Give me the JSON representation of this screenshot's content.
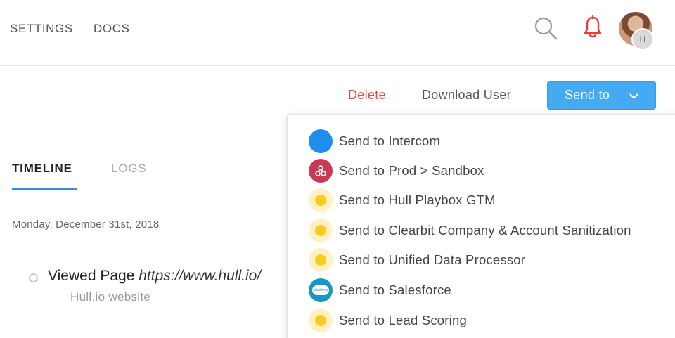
{
  "nav": {
    "settings_label": "SETTINGS",
    "docs_label": "DOCS",
    "search_icon": "search-icon",
    "bell_icon": "bell-icon",
    "avatar_badge": "H",
    "bell_color": "#ef3b3b"
  },
  "actions": {
    "delete_label": "Delete",
    "download_label": "Download User",
    "sendto_label": "Send to",
    "accent_color": "#45aaf2",
    "delete_color": "#e8473b"
  },
  "tabs": {
    "timeline_label": "TIMELINE",
    "logs_label": "LOGS"
  },
  "timeline": {
    "date": "Monday, December 31st, 2018",
    "event_title": "Viewed Page",
    "event_url": "https://www.hull.io/",
    "event_sub": "Hull.io website"
  },
  "dropdown": {
    "items": [
      {
        "label": "Send to Intercom",
        "icon": "intercom-icon"
      },
      {
        "label": "Send to Prod > Sandbox",
        "icon": "hull-icon"
      },
      {
        "label": "Send to Hull Playbox GTM",
        "icon": "sun-icon"
      },
      {
        "label": "Send to Clearbit Company & Account Sanitization",
        "icon": "sun-icon"
      },
      {
        "label": "Send to Unified Data Processor",
        "icon": "sun-icon"
      },
      {
        "label": "Send to Salesforce",
        "icon": "salesforce-icon"
      },
      {
        "label": "Send to Lead Scoring",
        "icon": "sun-icon"
      }
    ],
    "salesforce_icon_text": "salesforce"
  }
}
